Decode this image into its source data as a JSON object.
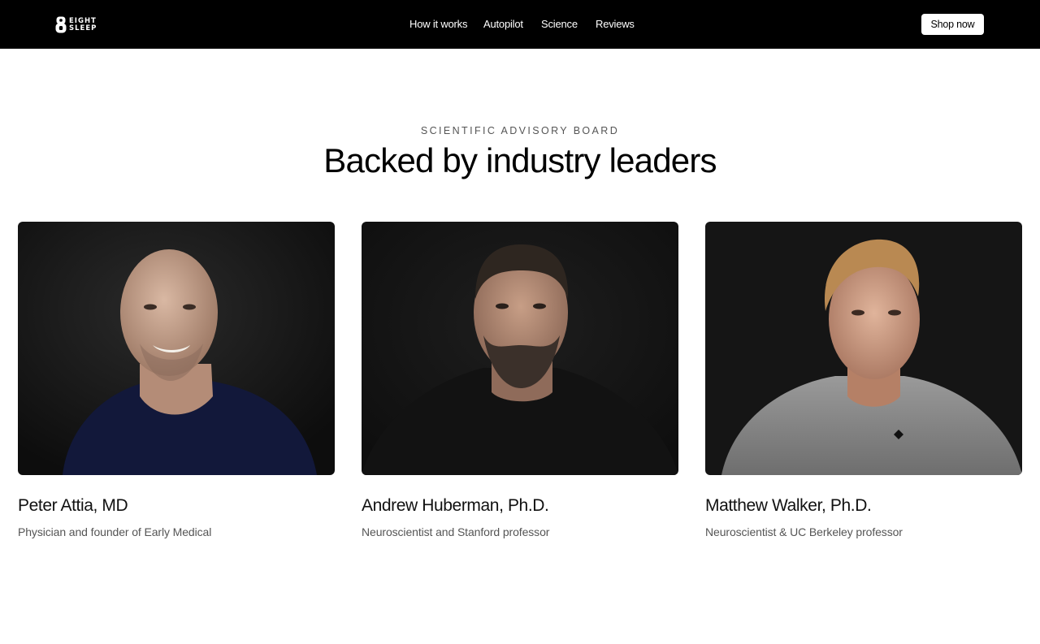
{
  "header": {
    "logo": {
      "icon": "eight-logo-icon",
      "line1": "EIGHT",
      "line2": "SLEEP"
    },
    "nav": [
      {
        "label": "How it works"
      },
      {
        "label": "Autopilot"
      },
      {
        "label": "Science"
      },
      {
        "label": "Reviews"
      }
    ],
    "cta_label": "Shop now"
  },
  "section": {
    "eyebrow": "SCIENTIFIC ADVISORY BOARD",
    "title": "Backed by industry leaders"
  },
  "advisors": [
    {
      "name": "Peter Attia, MD",
      "role": "Physician and founder of Early Medical"
    },
    {
      "name": "Andrew Huberman, Ph.D.",
      "role": "Neuroscientist and Stanford professor"
    },
    {
      "name": "Matthew Walker, Ph.D.",
      "role": "Neuroscientist & UC Berkeley professor"
    }
  ],
  "colors": {
    "header_bg": "#000000",
    "page_bg": "#ffffff",
    "photo_bg": "#141414"
  }
}
